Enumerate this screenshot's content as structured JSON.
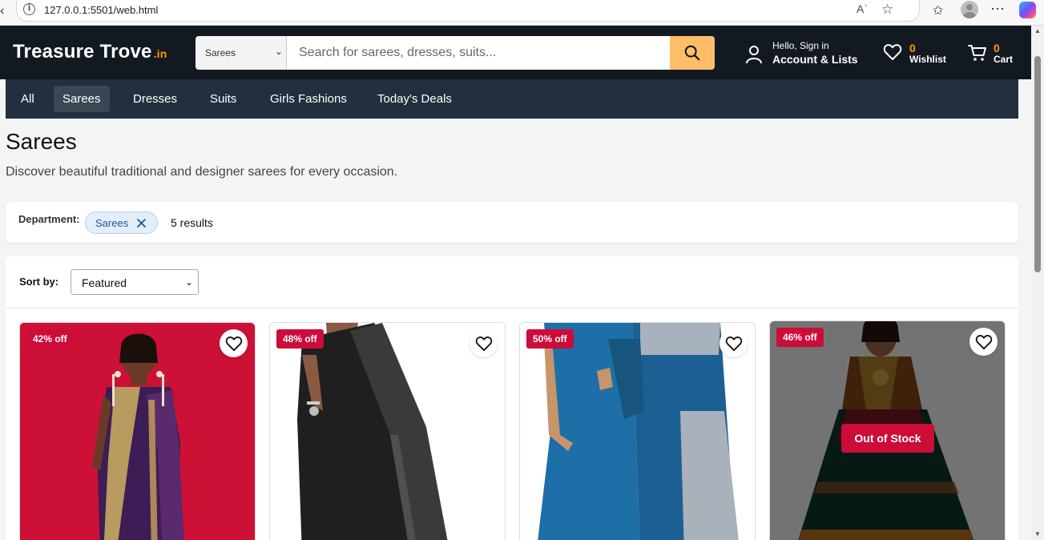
{
  "browser": {
    "url": "127.0.0.1:5501/web.html",
    "back_glyph": "‹",
    "readaloud_glyph": "Aʾ",
    "favorite_glyph": "☆",
    "favorites_glyph": "✩",
    "more_glyph": "⋯"
  },
  "header": {
    "logo": "Treasure Trove",
    "logo_suffix": ".in",
    "search_category": "Sarees",
    "search_placeholder": "Search for sarees, dresses, suits...",
    "account_greeting": "Hello, Sign in",
    "account_title": "Account & Lists",
    "wishlist_count": "0",
    "wishlist_label": "Wishlist",
    "cart_count": "0",
    "cart_label": "Cart"
  },
  "nav": {
    "items": [
      "All",
      "Sarees",
      "Dresses",
      "Suits",
      "Girls Fashions",
      "Today's Deals"
    ],
    "active": "Sarees"
  },
  "page": {
    "title": "Sarees",
    "subtitle": "Discover beautiful traditional and designer sarees for every occasion."
  },
  "filters": {
    "label": "Department:",
    "chip": "Sarees",
    "results": "5 results"
  },
  "sort": {
    "label": "Sort by:",
    "value": "Featured"
  },
  "products": [
    {
      "discount": "42% off",
      "out_of_stock": false
    },
    {
      "discount": "48% off",
      "out_of_stock": false
    },
    {
      "discount": "50% off",
      "out_of_stock": false
    },
    {
      "discount": "46% off",
      "out_of_stock": true,
      "stock_label": "Out of Stock"
    }
  ],
  "colors": {
    "header_bg": "#131921",
    "subnav_bg": "#232f3e",
    "accent": "#ff9900",
    "search_button": "#febd69",
    "badge": "#cc0c39"
  }
}
